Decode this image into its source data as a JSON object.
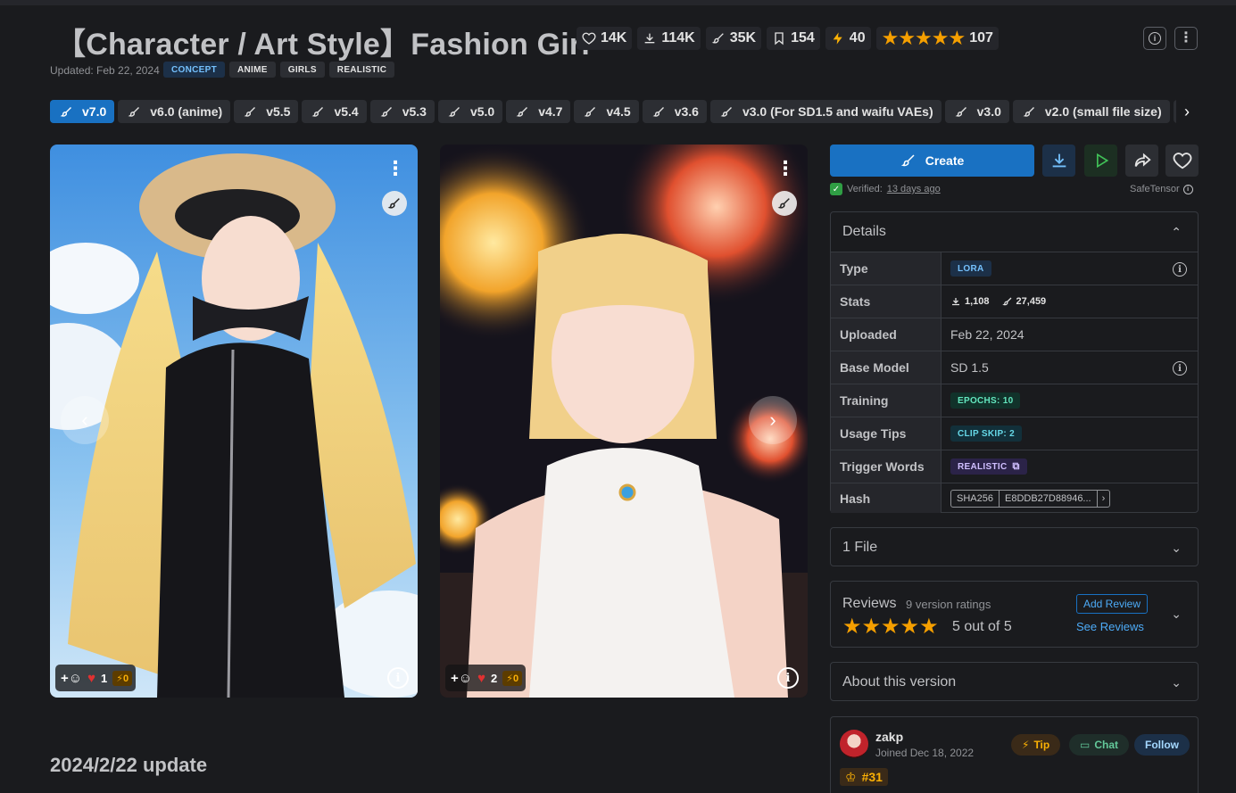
{
  "header": {
    "title": "【Character / Art Style】Fashion Girl",
    "stats": {
      "likes": "14K",
      "downloads": "114K",
      "generations": "35K",
      "collections": "154",
      "buzz": "40",
      "rating_count": "107",
      "stars": "★★★★★"
    },
    "updated": "Updated: Feb 22, 2024",
    "tags": [
      "CONCEPT",
      "ANIME",
      "GIRLS",
      "REALISTIC"
    ]
  },
  "versions": [
    "v7.0",
    "v6.0 (anime)",
    "v5.5",
    "v5.4",
    "v5.3",
    "v5.0",
    "v4.7",
    "v4.5",
    "v3.6",
    "v3.0 (For SD1.5 and waifu VAEs)",
    "v3.0",
    "v2.0 (small file size)",
    ""
  ],
  "gallery": [
    {
      "likes": "1",
      "buzz": "0"
    },
    {
      "likes": "2",
      "buzz": "0"
    }
  ],
  "section_heading": "2024/2/22 update",
  "actions": {
    "create_label": "Create",
    "verified_label": "Verified:",
    "verified_time": "13 days ago",
    "safetensor_label": "SafeTensor"
  },
  "details": {
    "title": "Details",
    "rows": {
      "type": {
        "label": "Type",
        "value": "LORA"
      },
      "stats": {
        "label": "Stats",
        "downloads": "1,108",
        "generations": "27,459"
      },
      "uploaded": {
        "label": "Uploaded",
        "value": "Feb 22, 2024"
      },
      "base_model": {
        "label": "Base Model",
        "value": "SD 1.5"
      },
      "training": {
        "label": "Training",
        "value": "EPOCHS: 10"
      },
      "usage_tips": {
        "label": "Usage Tips",
        "value": "CLIP SKIP: 2"
      },
      "trigger_words": {
        "label": "Trigger Words",
        "value": "REALISTIC"
      },
      "hash": {
        "label": "Hash",
        "algo": "SHA256",
        "value": "E8DDB27D88946..."
      }
    }
  },
  "files": {
    "title": "1 File"
  },
  "reviews": {
    "title": "Reviews",
    "count": "9 version ratings",
    "stars": "★★★★★",
    "score": "5 out of 5",
    "add_label": "Add Review",
    "see_label": "See Reviews"
  },
  "about": {
    "title": "About this version"
  },
  "creator": {
    "name": "zakp",
    "joined": "Joined Dec 18, 2022",
    "tip_label": "Tip",
    "chat_label": "Chat",
    "follow_label": "Follow",
    "rank": "#31"
  },
  "colors": {
    "background": "#1a1b1e",
    "accent": "#1971c2",
    "star": "#f59f00",
    "play": "#40c057"
  }
}
